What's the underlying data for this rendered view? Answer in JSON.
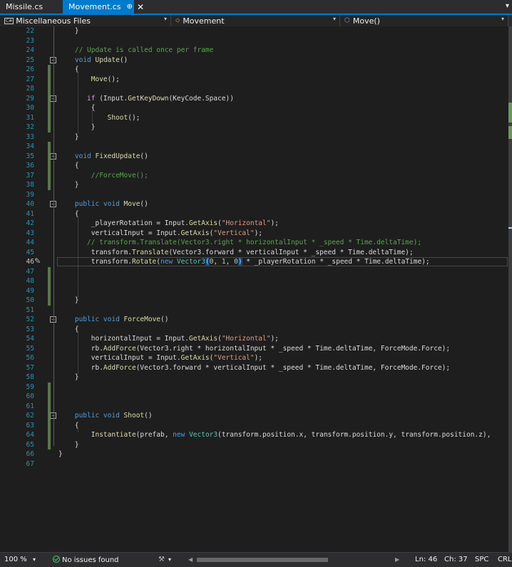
{
  "tabs": [
    {
      "label": "Missile.cs",
      "active": false
    },
    {
      "label": "Movement.cs",
      "active": true,
      "pin_glyph": "⊕",
      "close_glyph": "✕"
    }
  ],
  "tab_overflow_glyph": "▾",
  "navbar": {
    "project": "Miscellaneous Files",
    "type": "Movement",
    "member": "Move()",
    "dropdown_glyph": "▾",
    "type_icon_glyph": "⬦",
    "member_icon_glyph": "⬡",
    "cs_badge": "C#"
  },
  "editor": {
    "first_line": 22,
    "current_line": 46,
    "pencil_glyph": "✎",
    "fold_collapse_glyph": "−",
    "lines": [
      [
        [
          "",
          "    }"
        ]
      ],
      [
        [
          "",
          ""
        ]
      ],
      [
        [
          "cm",
          "    // Update is called once per frame"
        ]
      ],
      [
        [
          "kw",
          "    void"
        ],
        [
          "",
          " "
        ],
        [
          "fn",
          "Update"
        ],
        [
          "",
          "()"
        ]
      ],
      [
        [
          "",
          "    {"
        ]
      ],
      [
        [
          "fn",
          "        Move"
        ],
        [
          "",
          "();"
        ]
      ],
      [
        [
          "",
          ""
        ]
      ],
      [
        [
          "ctl",
          "       if"
        ],
        [
          "",
          " (Input."
        ],
        [
          "fn",
          "GetKeyDown"
        ],
        [
          "",
          "(KeyCode.Space))"
        ]
      ],
      [
        [
          "",
          "        {"
        ]
      ],
      [
        [
          "fn",
          "            Shoot"
        ],
        [
          "",
          "();"
        ]
      ],
      [
        [
          "",
          "        }"
        ]
      ],
      [
        [
          "",
          "    }"
        ]
      ],
      [
        [
          "",
          ""
        ]
      ],
      [
        [
          "kw",
          "    void"
        ],
        [
          "",
          " "
        ],
        [
          "fn",
          "FixedUpdate"
        ],
        [
          "",
          "()"
        ]
      ],
      [
        [
          "",
          "    {"
        ]
      ],
      [
        [
          "cm",
          "        //ForceMove();"
        ]
      ],
      [
        [
          "",
          "    }"
        ]
      ],
      [
        [
          "",
          ""
        ]
      ],
      [
        [
          "kw",
          "    public void"
        ],
        [
          "",
          " "
        ],
        [
          "fn",
          "Move"
        ],
        [
          "",
          "()"
        ]
      ],
      [
        [
          "",
          "    {"
        ]
      ],
      [
        [
          "",
          "        _playerRotation = Input."
        ],
        [
          "fn",
          "GetAxis"
        ],
        [
          "",
          "("
        ],
        [
          "str",
          "\"Horizontal\""
        ],
        [
          "",
          ");"
        ]
      ],
      [
        [
          "",
          "        verticalInput = Input."
        ],
        [
          "fn",
          "GetAxis"
        ],
        [
          "",
          "("
        ],
        [
          "str",
          "\"Vertical\""
        ],
        [
          "",
          ");"
        ]
      ],
      [
        [
          "cm",
          "       // transform.Translate(Vector3.right * horizontalInput * _speed * Time.deltaTime);"
        ]
      ],
      [
        [
          "",
          "        transform."
        ],
        [
          "fn",
          "Translate"
        ],
        [
          "",
          "(Vector3.forward * verticalInput * _speed * Time.deltaTime);"
        ]
      ],
      [
        [
          "",
          "        transform."
        ],
        [
          "fn",
          "Rotate"
        ],
        [
          "",
          "("
        ],
        [
          "kw",
          "new"
        ],
        [
          "",
          " "
        ],
        [
          "cls",
          "Vector3"
        ],
        [
          "brace-hl",
          "("
        ],
        [
          "num",
          "0"
        ],
        [
          "",
          ", "
        ],
        [
          "num",
          "1"
        ],
        [
          "",
          ", "
        ],
        [
          "num",
          "0"
        ],
        [
          "brace-hl",
          ")"
        ],
        [
          "",
          " * _playerRotation * _speed * Time.deltaTime);"
        ]
      ],
      [
        [
          "",
          ""
        ]
      ],
      [
        [
          "",
          ""
        ]
      ],
      [
        [
          "",
          ""
        ]
      ],
      [
        [
          "",
          "    }"
        ]
      ],
      [
        [
          "",
          ""
        ]
      ],
      [
        [
          "kw",
          "    public void"
        ],
        [
          "",
          " "
        ],
        [
          "fn",
          "ForceMove"
        ],
        [
          "",
          "()"
        ]
      ],
      [
        [
          "",
          "    {"
        ]
      ],
      [
        [
          "",
          "        horizontalInput = Input."
        ],
        [
          "fn",
          "GetAxis"
        ],
        [
          "",
          "("
        ],
        [
          "str",
          "\"Horizontal\""
        ],
        [
          "",
          ");"
        ]
      ],
      [
        [
          "",
          "        rb."
        ],
        [
          "fn",
          "AddForce"
        ],
        [
          "",
          "(Vector3.right * horizontalInput * _speed * Time.deltaTime, ForceMode.Force);"
        ]
      ],
      [
        [
          "",
          "        verticalInput = Input."
        ],
        [
          "fn",
          "GetAxis"
        ],
        [
          "",
          "("
        ],
        [
          "str",
          "\"Vertical\""
        ],
        [
          "",
          ");"
        ]
      ],
      [
        [
          "",
          "        rb."
        ],
        [
          "fn",
          "AddForce"
        ],
        [
          "",
          "(Vector3.forward * verticalInput * _speed * Time.deltaTime, ForceMode.Force);"
        ]
      ],
      [
        [
          "",
          "    }"
        ]
      ],
      [
        [
          "",
          ""
        ]
      ],
      [
        [
          "",
          ""
        ]
      ],
      [
        [
          "",
          ""
        ]
      ],
      [
        [
          "kw",
          "    public void"
        ],
        [
          "",
          " "
        ],
        [
          "fn",
          "Shoot"
        ],
        [
          "",
          "()"
        ]
      ],
      [
        [
          "",
          "    {"
        ]
      ],
      [
        [
          "fn",
          "        Instantiate"
        ],
        [
          "",
          "(prefab, "
        ],
        [
          "kw",
          "new"
        ],
        [
          "",
          " "
        ],
        [
          "cls",
          "Vector3"
        ],
        [
          "",
          "(transform.position.x, transform.position.y, transform.position.z),"
        ]
      ],
      [
        [
          "",
          "    }"
        ]
      ],
      [
        [
          "",
          "}"
        ]
      ],
      [
        [
          "",
          ""
        ]
      ]
    ]
  },
  "colors": {
    "accent": "#007acc",
    "keyword": "#569cd6",
    "control": "#d8a0df",
    "string": "#d69d85",
    "comment": "#57a64a",
    "type": "#4ec9b0",
    "method": "#dcdcaa",
    "number": "#b5cea8",
    "line_number": "#2b91af",
    "change_bar": "#6a9955"
  },
  "status": {
    "zoom": "100 %",
    "zoom_dd": "▾",
    "issues": "No issues found",
    "brush_glyph": "⚒",
    "brush_dd": "▾",
    "scroll_left": "◀",
    "scroll_right": "▶",
    "line": "Ln: 46",
    "col": "Ch: 37",
    "spacing": "SPC",
    "eol": "CRLF"
  }
}
